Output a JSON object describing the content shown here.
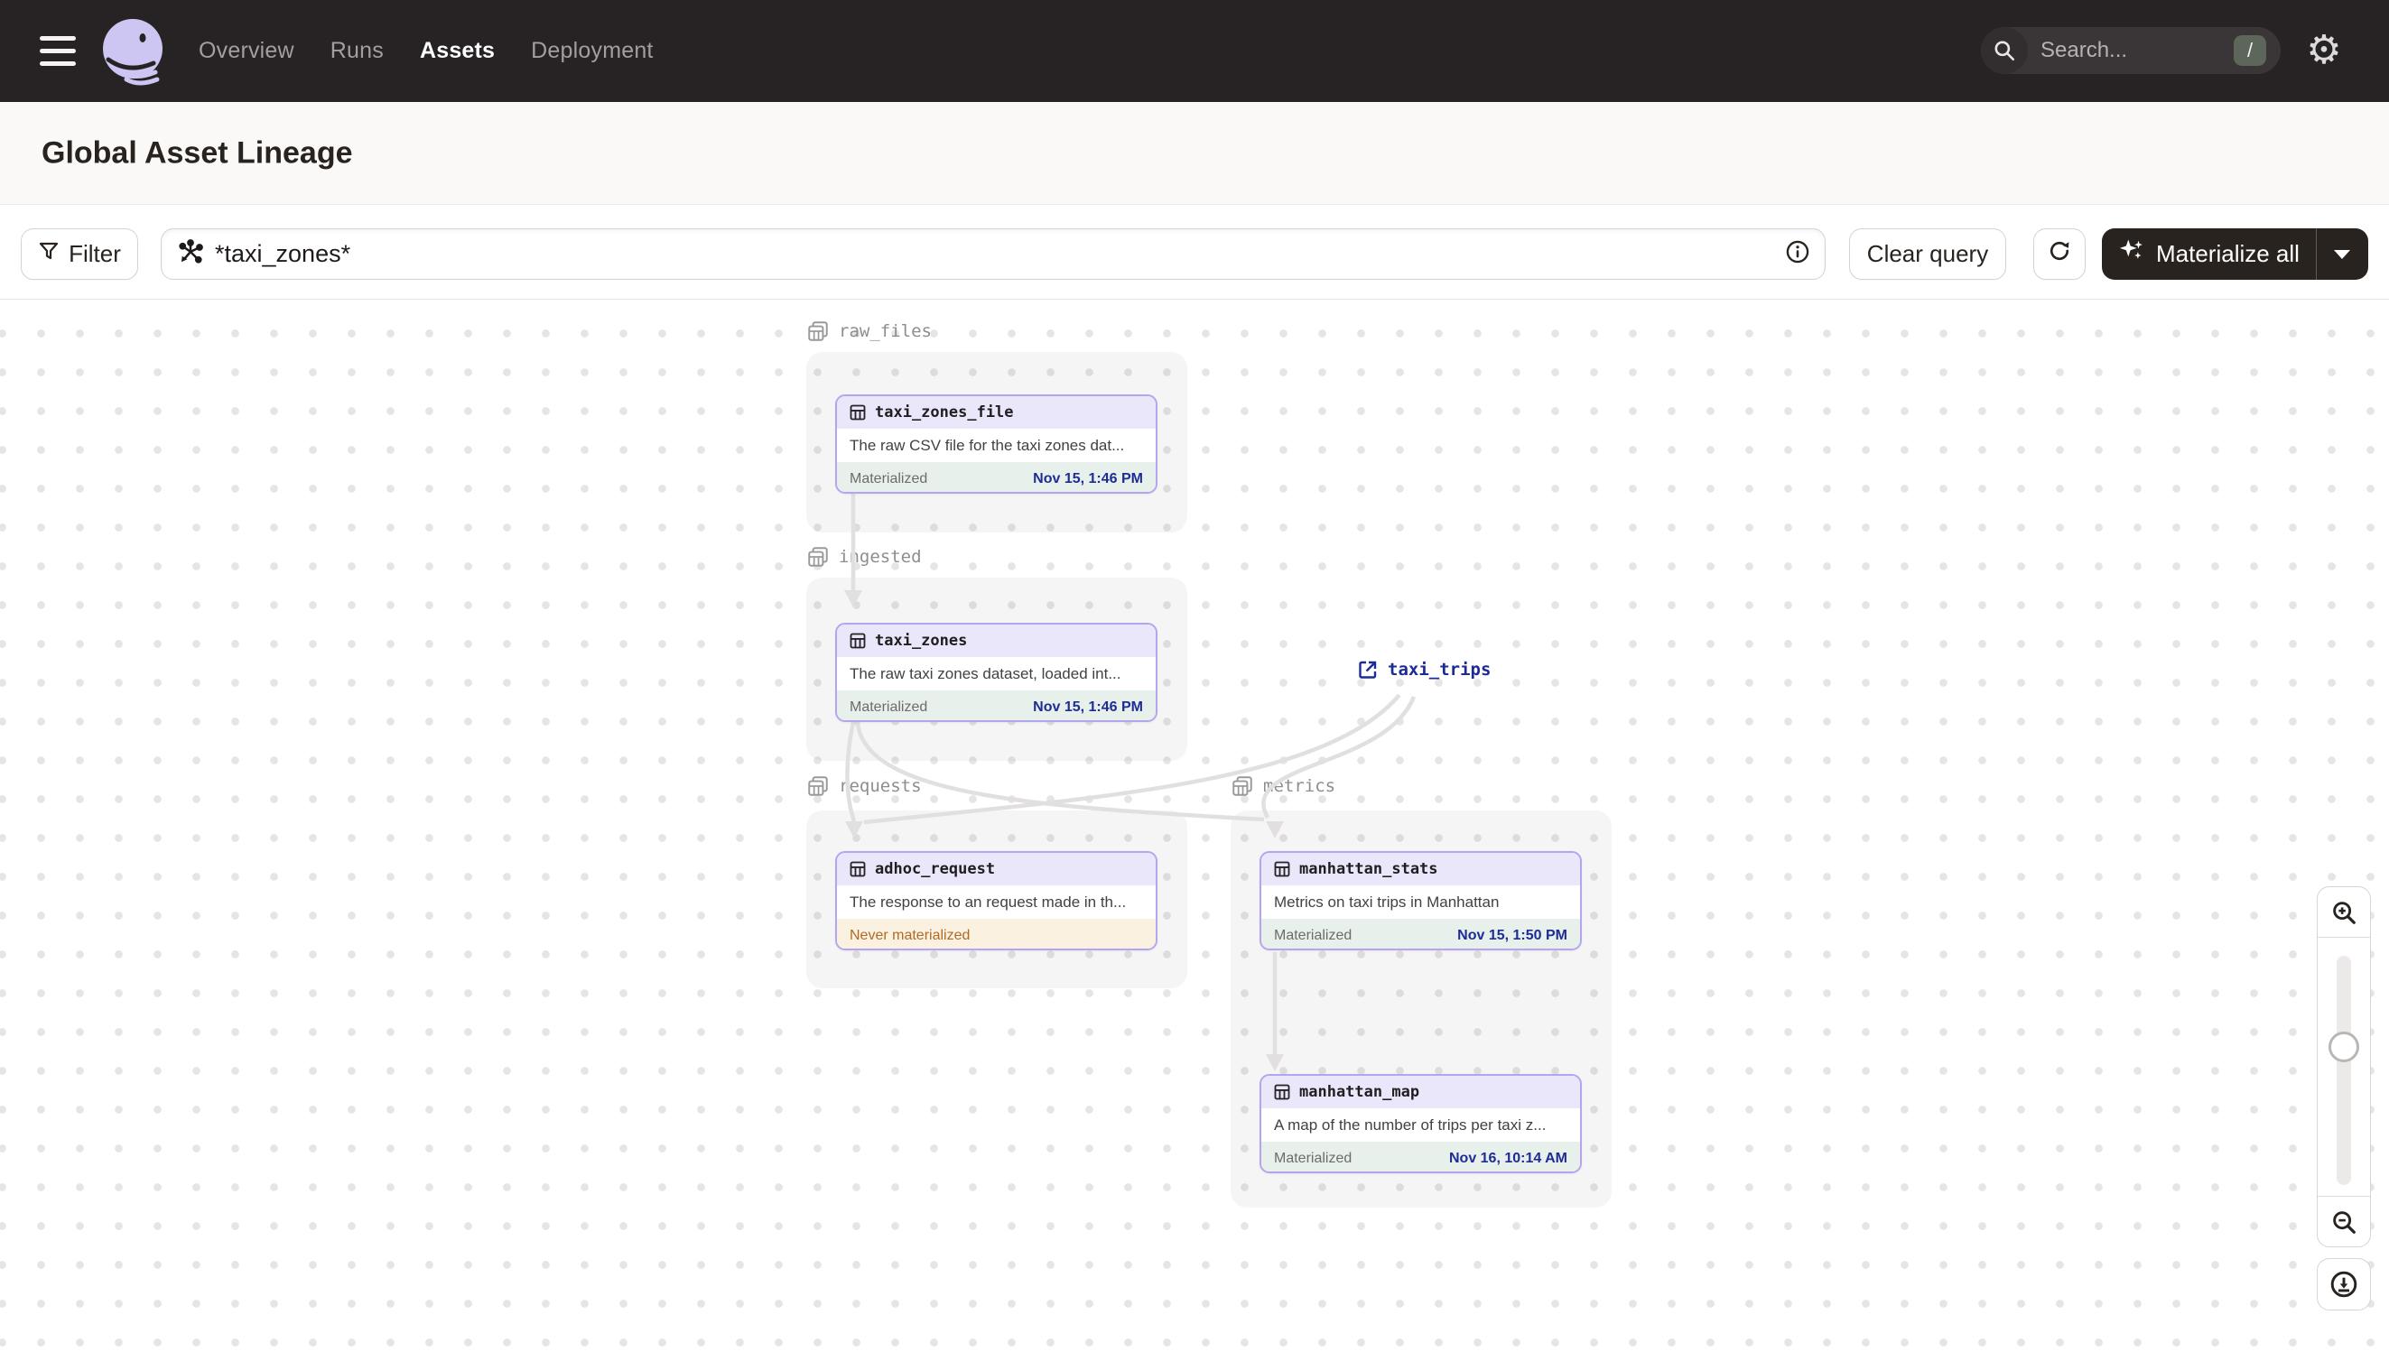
{
  "topbar": {
    "nav": [
      {
        "label": "Overview",
        "active": false
      },
      {
        "label": "Runs",
        "active": false
      },
      {
        "label": "Assets",
        "active": true
      },
      {
        "label": "Deployment",
        "active": false
      }
    ],
    "search": {
      "placeholder": "Search...",
      "shortcut": "/"
    }
  },
  "header": {
    "title": "Global Asset Lineage",
    "reload_label": "Reload definitions"
  },
  "toolbar": {
    "filter_label": "Filter",
    "query_value": "*taxi_zones*",
    "clear_label": "Clear query",
    "materialize_label": "Materialize all"
  },
  "graph": {
    "groups": [
      {
        "name": "raw_files"
      },
      {
        "name": "ingested"
      },
      {
        "name": "requests"
      },
      {
        "name": "metrics"
      }
    ],
    "nodes": [
      {
        "id": "taxi_zones_file",
        "group": "raw_files",
        "description": "The raw CSV file for the taxi zones dat...",
        "status": "Materialized",
        "timestamp": "Nov 15, 1:46 PM"
      },
      {
        "id": "taxi_zones",
        "group": "ingested",
        "description": "The raw taxi zones dataset, loaded int...",
        "status": "Materialized",
        "timestamp": "Nov 15, 1:46 PM"
      },
      {
        "id": "adhoc_request",
        "group": "requests",
        "description": "The response to an request made in th...",
        "status": "Never materialized",
        "timestamp": ""
      },
      {
        "id": "manhattan_stats",
        "group": "metrics",
        "description": "Metrics on taxi trips in Manhattan",
        "status": "Materialized",
        "timestamp": "Nov 15, 1:50 PM"
      },
      {
        "id": "manhattan_map",
        "group": "metrics",
        "description": "A map of the number of trips per taxi z...",
        "status": "Materialized",
        "timestamp": "Nov 16, 10:14 AM"
      }
    ],
    "external_assets": [
      {
        "id": "taxi_trips"
      }
    ],
    "edges": [
      {
        "from": "taxi_zones_file",
        "to": "taxi_zones"
      },
      {
        "from": "taxi_zones",
        "to": "adhoc_request"
      },
      {
        "from": "taxi_zones",
        "to": "manhattan_stats"
      },
      {
        "from": "taxi_trips",
        "to": "adhoc_request"
      },
      {
        "from": "taxi_trips",
        "to": "manhattan_stats"
      },
      {
        "from": "manhattan_stats",
        "to": "manhattan_map"
      }
    ]
  },
  "colors": {
    "topbar_bg": "#272223",
    "accent_lavender": "#b3a6ee",
    "node_header_bg": "#eae7fa",
    "materialized_green_bg": "#e7f0ea",
    "timestamp_navy": "#1d2d95",
    "never_materialized_orange": "#b06a24",
    "never_materialized_bg": "#fbf1e0",
    "edge_gray": "#e1dfe0",
    "external_link_navy": "#1c2b96"
  }
}
